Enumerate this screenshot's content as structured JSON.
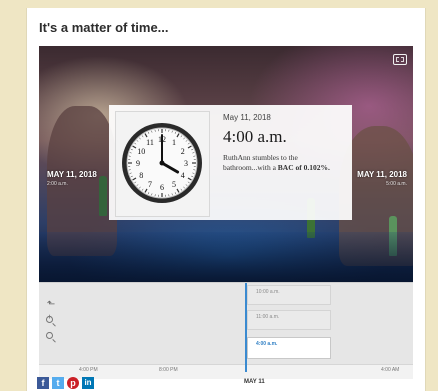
{
  "page": {
    "heading": "It's a matter of time..."
  },
  "slide": {
    "date": "May 11, 2018",
    "time": "4:00 a.m.",
    "description": "RuthAnn stumbles to the bathroom...with a",
    "description_bold": "BAC of 0.102%.",
    "clock_hour": 4,
    "clock_minute": 0,
    "clock_numbers": [
      "12",
      "1",
      "2",
      "3",
      "4",
      "5",
      "6",
      "7",
      "8",
      "9",
      "10",
      "11"
    ]
  },
  "side_labels": {
    "prev_date": "MAY 11, 2018",
    "prev_time": "2:00 a.m.",
    "next_date": "MAY 11, 2018",
    "next_time": "5:00 a.m."
  },
  "timeline": {
    "events": [
      "10:00 a.m.",
      "11:00 a.m.",
      "4:00 a.m."
    ],
    "ticks": [
      "4:00 PM",
      "8:00 PM",
      "4:00 AM"
    ],
    "current_date": "MAY 11"
  },
  "icons": {
    "expand": "expand-icon",
    "back": "back-arrow-icon",
    "zoom_in": "zoom-in-icon",
    "zoom_out": "zoom-out-icon"
  },
  "share": {
    "facebook": "f",
    "twitter": "t",
    "pinterest": "p",
    "linkedin": "in"
  },
  "colors": {
    "accent": "#3a8ad0",
    "background": "#efe6c4"
  }
}
